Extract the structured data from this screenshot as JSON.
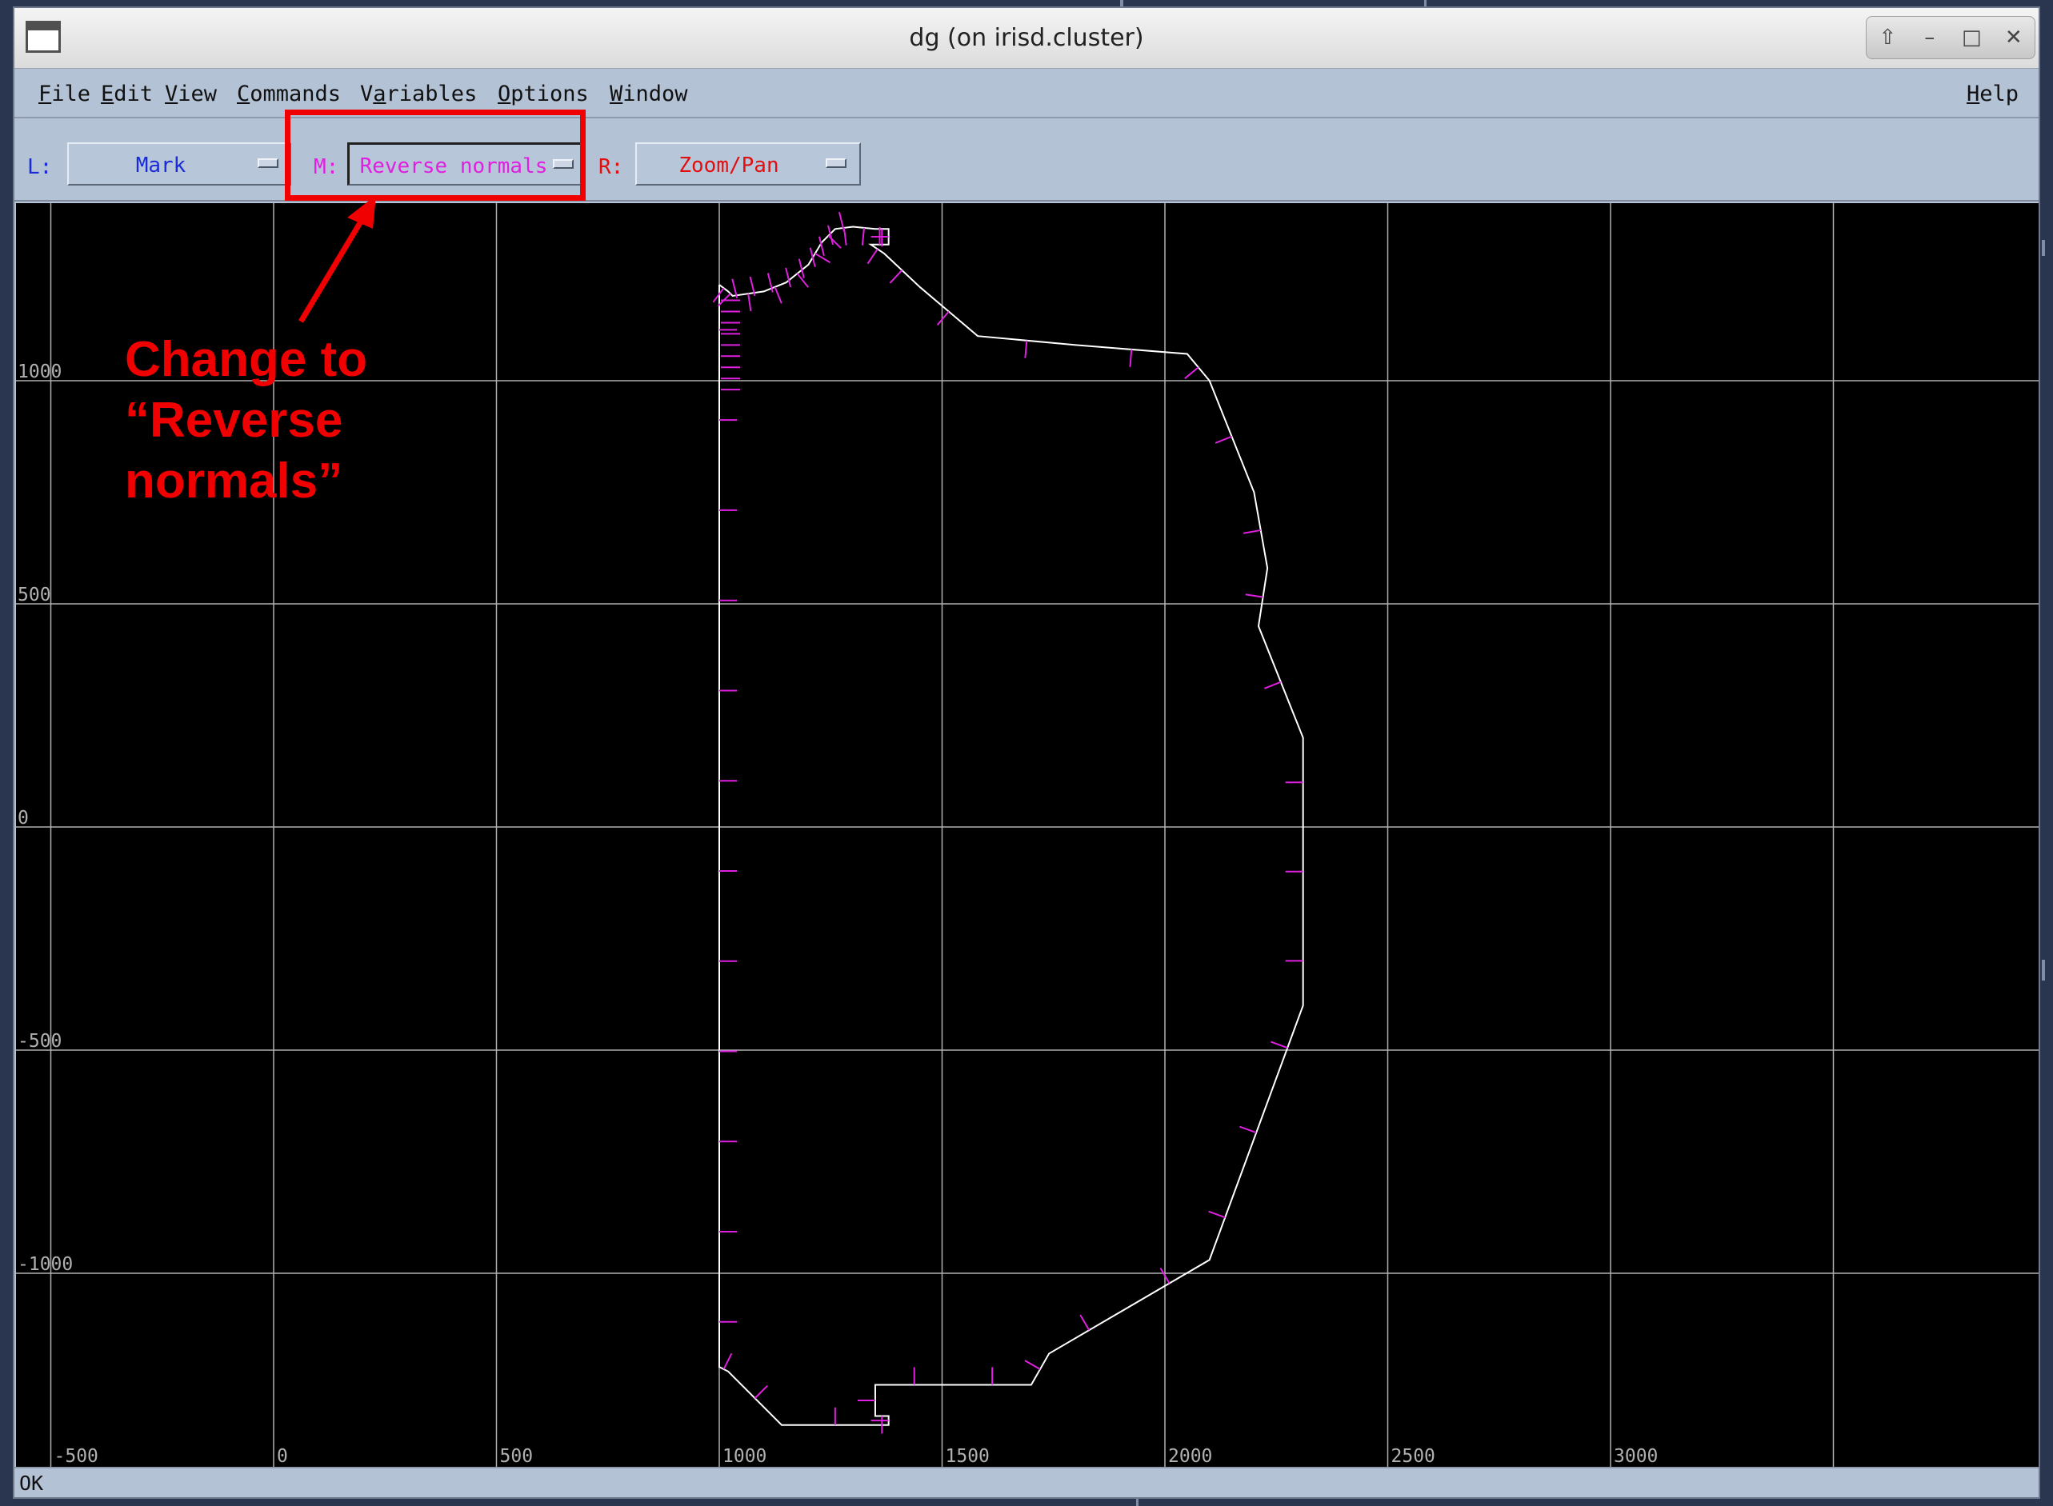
{
  "window": {
    "title": "dg (on irisd.cluster)"
  },
  "menubar": {
    "items": [
      {
        "label": "File",
        "mnemonic": "F"
      },
      {
        "label": "Edit",
        "mnemonic": "E"
      },
      {
        "label": "View",
        "mnemonic": "V"
      },
      {
        "label": "Commands",
        "mnemonic": "C"
      },
      {
        "label": "Variables",
        "mnemonic": "a"
      },
      {
        "label": "Options",
        "mnemonic": "O"
      },
      {
        "label": "Window",
        "mnemonic": "W"
      }
    ],
    "help": {
      "label": "Help",
      "mnemonic": "H"
    }
  },
  "toolbar": {
    "left": {
      "prefix": "L:",
      "value": "Mark",
      "color": "#1a2ad8"
    },
    "middle": {
      "prefix": "M:",
      "value": "Reverse normals",
      "color": "#e020e0"
    },
    "right": {
      "prefix": "R:",
      "value": "Zoom/Pan",
      "color": "#e01010"
    }
  },
  "annotation": {
    "lines": [
      "Change to",
      "“Reverse",
      "normals”"
    ],
    "color": "#f00000"
  },
  "plot": {
    "x_ticks": [
      "-500",
      "0",
      "500",
      "1000",
      "1500",
      "2000",
      "2500",
      "3000"
    ],
    "y_ticks": [
      "1000",
      "500",
      "0",
      "-500",
      "-1000"
    ],
    "grid": true,
    "colors": {
      "background": "#000000",
      "grid": "#b0b0b0",
      "outline": "#ffffff",
      "normals": "#e020e0"
    },
    "outline": [
      [
        1000,
        1215
      ],
      [
        1020,
        1200
      ],
      [
        1030,
        1190
      ],
      [
        1100,
        1200
      ],
      [
        1150,
        1220
      ],
      [
        1200,
        1260
      ],
      [
        1230,
        1310
      ],
      [
        1260,
        1340
      ],
      [
        1300,
        1345
      ],
      [
        1350,
        1340
      ],
      [
        1380,
        1340
      ],
      [
        1380,
        1305
      ],
      [
        1340,
        1305
      ],
      [
        1370,
        1285
      ],
      [
        1450,
        1210
      ],
      [
        1580,
        1100
      ],
      [
        1800,
        1080
      ],
      [
        2050,
        1060
      ],
      [
        2100,
        1000
      ],
      [
        2200,
        750
      ],
      [
        2230,
        580
      ],
      [
        2210,
        450
      ],
      [
        2310,
        200
      ],
      [
        2310,
        -400
      ],
      [
        2100,
        -970
      ],
      [
        1740,
        -1180
      ],
      [
        1700,
        -1250
      ],
      [
        1350,
        -1250
      ],
      [
        1350,
        -1320
      ],
      [
        1380,
        -1320
      ],
      [
        1380,
        -1340
      ],
      [
        1140,
        -1340
      ],
      [
        1020,
        -1220
      ],
      [
        1000,
        -1210
      ],
      [
        1000,
        1215
      ]
    ]
  },
  "status": {
    "text": "OK"
  }
}
